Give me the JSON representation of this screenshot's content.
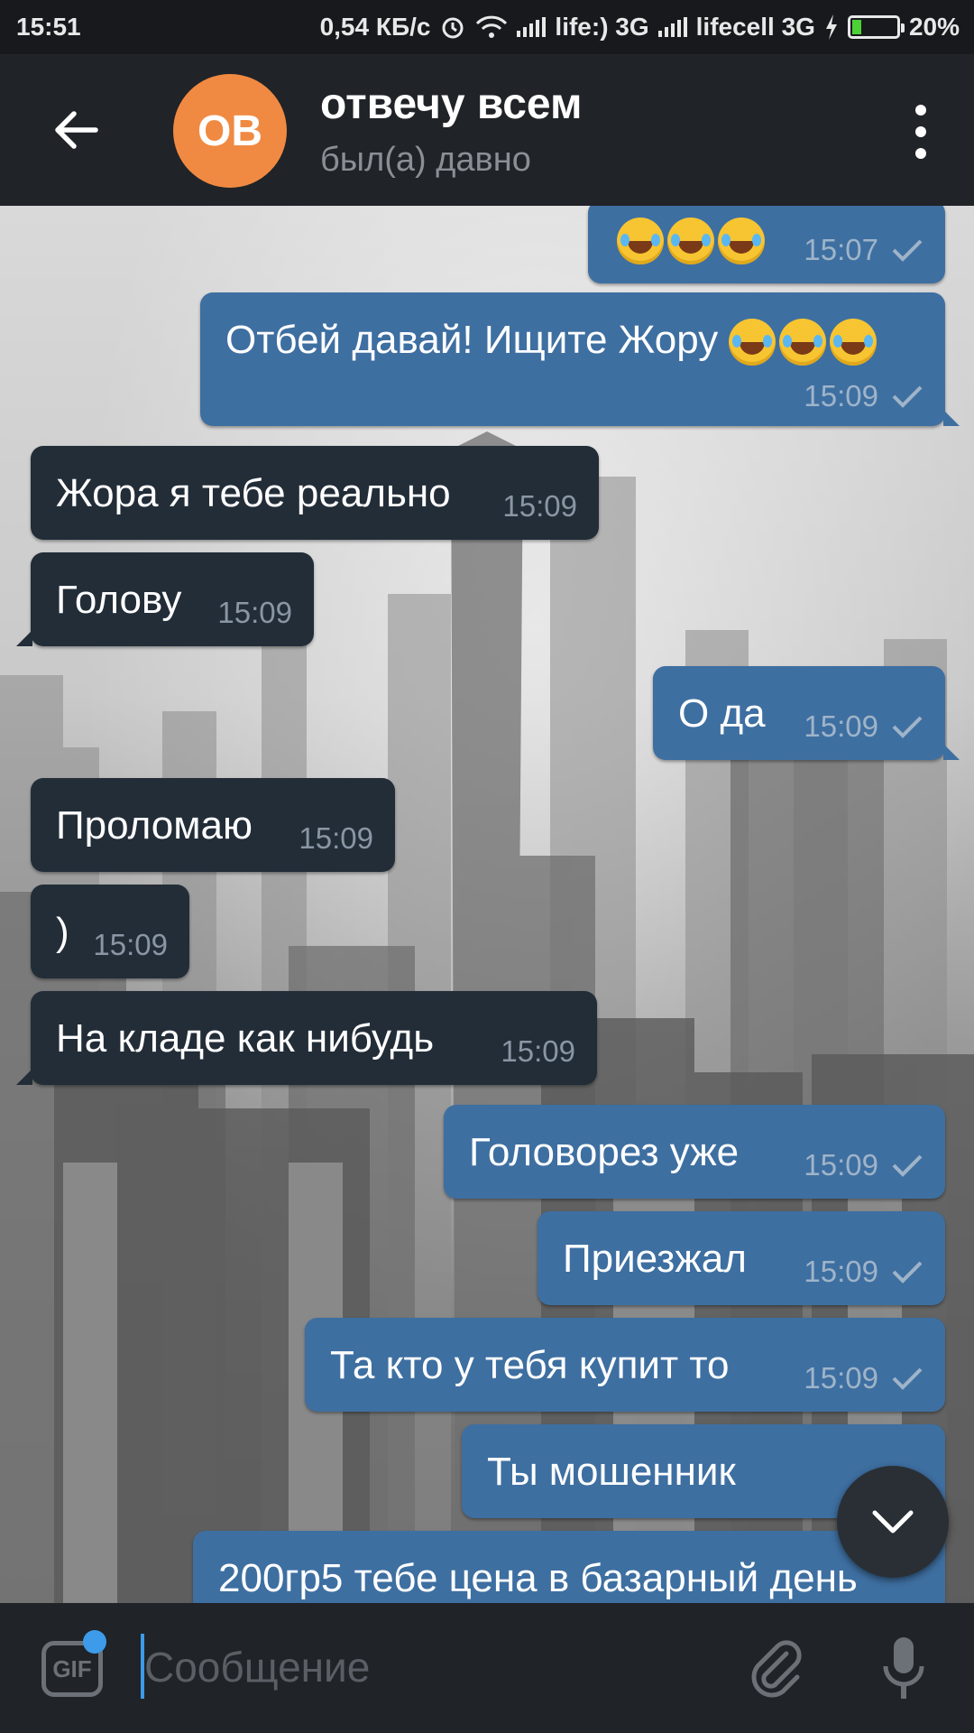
{
  "status_bar": {
    "time": "15:51",
    "speed": "0,54 КБ/с",
    "carrier1": "life:) 3G",
    "carrier2": "lifecell 3G",
    "battery": "20%",
    "battery_level": 0.2
  },
  "header": {
    "avatar_initials": "OB",
    "title": "отвечу всем",
    "subtitle": "был(а) давно"
  },
  "messages": [
    {
      "dir": "out",
      "text": "",
      "emoji_count": 3,
      "time": "15:07"
    },
    {
      "dir": "out",
      "text": "Отбей давай! Ищите Жору",
      "emoji_count": 3,
      "time": "15:09"
    },
    {
      "dir": "in",
      "text": "Жора я тебе реально",
      "time": "15:09"
    },
    {
      "dir": "in",
      "text": "Голову",
      "time": "15:09"
    },
    {
      "dir": "out",
      "text": "О да",
      "time": "15:09"
    },
    {
      "dir": "in",
      "text": "Проломаю",
      "time": "15:09"
    },
    {
      "dir": "in",
      "text": ")",
      "time": "15:09"
    },
    {
      "dir": "in",
      "text": "На кладе как нибудь",
      "time": "15:09"
    },
    {
      "dir": "out",
      "text": "Головорез уже",
      "time": "15:09"
    },
    {
      "dir": "out",
      "text": "Приезжал",
      "time": "15:09"
    },
    {
      "dir": "out",
      "text": "Та кто у тебя купит то",
      "time": "15:09"
    },
    {
      "dir": "out",
      "text": "Ты мошенник",
      "time": "15:0"
    },
    {
      "dir": "out",
      "text": "200гр5 тебе цена в базарный день",
      "time": ""
    }
  ],
  "input": {
    "gif_label": "GIF",
    "placeholder": "Сообщение"
  },
  "colors": {
    "outgoing_bubble": "#3e6fa1",
    "incoming_bubble": "#222d38",
    "avatar": "#f08a42",
    "accent": "#3d9be9"
  }
}
